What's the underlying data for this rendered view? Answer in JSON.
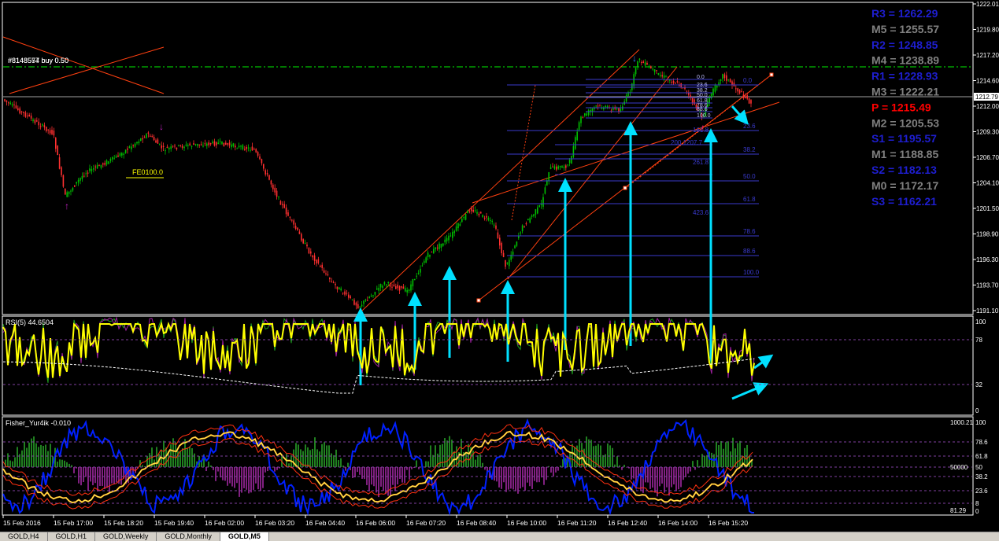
{
  "colors": {
    "background": "#000000",
    "frame": "#ffffff",
    "bull": "#00c000",
    "bear": "#ff3030",
    "resistance": "#1e1ed0",
    "pivot": "#ff0000",
    "mid": "#808080",
    "fib": "#3a3acc",
    "rsi": "#ffff00",
    "arrow": "#00e0ff",
    "dash_green": "#00c000",
    "trend": "#ff4010"
  },
  "price_axis": {
    "labels": [
      "1222.01",
      "1219.80",
      "1217.20",
      "1214.60",
      "1212.00",
      "1209.30",
      "1206.70",
      "1204.10",
      "1201.50",
      "1198.90",
      "1196.30",
      "1193.70",
      "1191.10"
    ],
    "current": "1212.79"
  },
  "trade_label": "#8148574 buy 0.50",
  "trade_label_b": "#8148557 buy 0.50",
  "fib_expansion_label": "FE0100.0",
  "pivots": [
    {
      "label": "R3 = 1262.29",
      "color": "#1e1ed0"
    },
    {
      "label": "M5 = 1255.57",
      "color": "#808080"
    },
    {
      "label": "R2 = 1248.85",
      "color": "#1e1ed0"
    },
    {
      "label": "M4 = 1238.89",
      "color": "#808080"
    },
    {
      "label": "R1 = 1228.93",
      "color": "#1e1ed0"
    },
    {
      "label": "M3 = 1222.21",
      "color": "#808080"
    },
    {
      "label": "P  = 1215.49",
      "color": "#ff0000"
    },
    {
      "label": "M2 = 1205.53",
      "color": "#808080"
    },
    {
      "label": "S1 = 1195.57",
      "color": "#1e1ed0"
    },
    {
      "label": "M1 = 1188.85",
      "color": "#808080"
    },
    {
      "label": "S2 = 1182.13",
      "color": "#1e1ed0"
    },
    {
      "label": "M0 = 1172.17",
      "color": "#808080"
    },
    {
      "label": "S3 = 1162.21",
      "color": "#1e1ed0"
    }
  ],
  "fib_levels": [
    "0.0",
    "23.6",
    "38.2",
    "50.0",
    "61.8",
    "78.6",
    "88.6",
    "100.0"
  ],
  "fib_left_levels": [
    "0.0",
    "23.6",
    "38.2",
    "50.0",
    "61.8",
    "78.6",
    "88.6",
    "100.0"
  ],
  "fib_ext": [
    "161.8",
    "200 1207.7",
    "261.8",
    "423.6"
  ],
  "rsi": {
    "title": "RSI(5) 44.6504",
    "labels": [
      "100",
      "78",
      "32",
      "0"
    ]
  },
  "fisher": {
    "title": "Fisher_Yur4ik -0.010",
    "labels": [
      "100",
      "78.6",
      "61.8",
      "50",
      "38.2",
      "23.6",
      "8",
      "0"
    ],
    "extra": [
      "1000.21",
      "50000",
      "81.29"
    ]
  },
  "time_axis": [
    "15 Feb 2016",
    "15 Feb 17:00",
    "15 Feb 18:20",
    "15 Feb 19:40",
    "16 Feb 02:00",
    "16 Feb 03:20",
    "16 Feb 04:40",
    "16 Feb 06:00",
    "16 Feb 07:20",
    "16 Feb 08:40",
    "16 Feb 10:00",
    "16 Feb 11:20",
    "16 Feb 12:40",
    "16 Feb 14:00",
    "16 Feb 15:20"
  ],
  "tabs": [
    {
      "label": "GOLD,H4",
      "active": false
    },
    {
      "label": "GOLD,H1",
      "active": false
    },
    {
      "label": "GOLD,Weekly",
      "active": false
    },
    {
      "label": "GOLD,Monthly",
      "active": false
    },
    {
      "label": "GOLD,M5",
      "active": true
    }
  ]
}
